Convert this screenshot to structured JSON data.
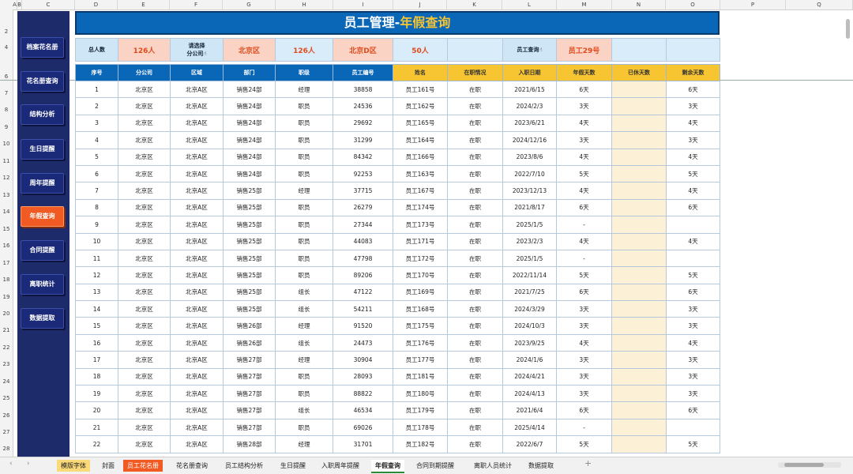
{
  "columns": [
    "A",
    "B",
    "C",
    "D",
    "E",
    "F",
    "G",
    "H",
    "I",
    "J",
    "K",
    "L",
    "M",
    "N",
    "O",
    "P",
    "Q"
  ],
  "rows": [
    "2",
    "4",
    "6",
    "7",
    "8",
    "9",
    "10",
    "11",
    "12",
    "13",
    "14",
    "15",
    "16",
    "17",
    "18",
    "19",
    "20",
    "21",
    "22",
    "23",
    "24",
    "25",
    "26",
    "27",
    "28"
  ],
  "sidebar": [
    {
      "label": "档案花名册",
      "active": false
    },
    {
      "label": "花名册查询",
      "active": false
    },
    {
      "label": "结构分析",
      "active": false
    },
    {
      "label": "生日提醒",
      "active": false
    },
    {
      "label": "周年提醒",
      "active": false
    },
    {
      "label": "年假查询",
      "active": true
    },
    {
      "label": "合同提醒",
      "active": false
    },
    {
      "label": "离职统计",
      "active": false
    },
    {
      "label": "数据提取",
      "active": false
    }
  ],
  "title": {
    "main": "员工管理-",
    "accent": "年假查询"
  },
  "info": {
    "total_label": "总人数",
    "total_value": "126人",
    "select_label": "请选择\n分公司☝",
    "branch_value": "北京区",
    "branch_count": "126人",
    "district_value": "北京D区",
    "district_count": "50人",
    "emp_query_label": "员工查询☝",
    "emp_query_value": "员工29号"
  },
  "headers": [
    "序号",
    "分公司",
    "区域",
    "部门",
    "职级",
    "员工编号",
    "姓名",
    "在职情况",
    "入职日期",
    "年假天数",
    "已休天数",
    "剩余天数"
  ],
  "table": [
    [
      "1",
      "北京区",
      "北京A区",
      "销售24部",
      "经理",
      "38858",
      "员工161号",
      "在职",
      "2021/6/15",
      "6天",
      "",
      "6天"
    ],
    [
      "2",
      "北京区",
      "北京A区",
      "销售24部",
      "职员",
      "24536",
      "员工162号",
      "在职",
      "2024/2/3",
      "3天",
      "",
      "3天"
    ],
    [
      "3",
      "北京区",
      "北京A区",
      "销售24部",
      "职员",
      "29692",
      "员工165号",
      "在职",
      "2023/6/21",
      "4天",
      "",
      "4天"
    ],
    [
      "4",
      "北京区",
      "北京A区",
      "销售24部",
      "职员",
      "31299",
      "员工164号",
      "在职",
      "2024/12/16",
      "3天",
      "",
      "3天"
    ],
    [
      "5",
      "北京区",
      "北京A区",
      "销售24部",
      "职员",
      "84342",
      "员工166号",
      "在职",
      "2023/8/6",
      "4天",
      "",
      "4天"
    ],
    [
      "6",
      "北京区",
      "北京A区",
      "销售24部",
      "职员",
      "92253",
      "员工163号",
      "在职",
      "2022/7/10",
      "5天",
      "",
      "5天"
    ],
    [
      "7",
      "北京区",
      "北京A区",
      "销售25部",
      "经理",
      "37715",
      "员工167号",
      "在职",
      "2023/12/13",
      "4天",
      "",
      "4天"
    ],
    [
      "8",
      "北京区",
      "北京A区",
      "销售25部",
      "职员",
      "26279",
      "员工174号",
      "在职",
      "2021/8/17",
      "6天",
      "",
      "6天"
    ],
    [
      "9",
      "北京区",
      "北京A区",
      "销售25部",
      "职员",
      "27344",
      "员工173号",
      "在职",
      "2025/1/5",
      "-",
      "",
      ""
    ],
    [
      "10",
      "北京区",
      "北京A区",
      "销售25部",
      "职员",
      "44083",
      "员工171号",
      "在职",
      "2023/2/3",
      "4天",
      "",
      "4天"
    ],
    [
      "11",
      "北京区",
      "北京A区",
      "销售25部",
      "职员",
      "47798",
      "员工172号",
      "在职",
      "2025/1/5",
      "-",
      "",
      ""
    ],
    [
      "12",
      "北京区",
      "北京A区",
      "销售25部",
      "职员",
      "89206",
      "员工170号",
      "在职",
      "2022/11/14",
      "5天",
      "",
      "5天"
    ],
    [
      "13",
      "北京区",
      "北京A区",
      "销售25部",
      "组长",
      "47122",
      "员工169号",
      "在职",
      "2021/7/25",
      "6天",
      "",
      "6天"
    ],
    [
      "14",
      "北京区",
      "北京A区",
      "销售25部",
      "组长",
      "54211",
      "员工168号",
      "在职",
      "2024/3/29",
      "3天",
      "",
      "3天"
    ],
    [
      "15",
      "北京区",
      "北京A区",
      "销售26部",
      "经理",
      "91520",
      "员工175号",
      "在职",
      "2024/10/3",
      "3天",
      "",
      "3天"
    ],
    [
      "16",
      "北京区",
      "北京A区",
      "销售26部",
      "组长",
      "24473",
      "员工176号",
      "在职",
      "2023/9/25",
      "4天",
      "",
      "4天"
    ],
    [
      "17",
      "北京区",
      "北京A区",
      "销售27部",
      "经理",
      "30904",
      "员工177号",
      "在职",
      "2024/1/6",
      "3天",
      "",
      "3天"
    ],
    [
      "18",
      "北京区",
      "北京A区",
      "销售27部",
      "职员",
      "28093",
      "员工181号",
      "在职",
      "2024/4/21",
      "3天",
      "",
      "3天"
    ],
    [
      "19",
      "北京区",
      "北京A区",
      "销售27部",
      "职员",
      "88822",
      "员工180号",
      "在职",
      "2024/4/13",
      "3天",
      "",
      "3天"
    ],
    [
      "20",
      "北京区",
      "北京A区",
      "销售27部",
      "组长",
      "46534",
      "员工179号",
      "在职",
      "2021/6/4",
      "6天",
      "",
      "6天"
    ],
    [
      "21",
      "北京区",
      "北京A区",
      "销售27部",
      "职员",
      "69026",
      "员工178号",
      "在职",
      "2025/4/14",
      "-",
      "",
      ""
    ],
    [
      "22",
      "北京区",
      "北京A区",
      "销售28部",
      "经理",
      "31701",
      "员工182号",
      "在职",
      "2022/6/7",
      "5天",
      "",
      "5天"
    ]
  ],
  "tabs": [
    {
      "label": "模版字体",
      "style": "yel"
    },
    {
      "label": "封面",
      "style": ""
    },
    {
      "label": "员工花名册",
      "style": "org"
    },
    {
      "label": "花名册查询",
      "style": ""
    },
    {
      "label": "员工结构分析",
      "style": ""
    },
    {
      "label": "生日提醒",
      "style": ""
    },
    {
      "label": "入职周年提醒",
      "style": ""
    },
    {
      "label": "年假查询",
      "style": "act"
    },
    {
      "label": "合同到期提醒",
      "style": ""
    },
    {
      "label": "离职人员统计",
      "style": ""
    },
    {
      "label": "数据提取",
      "style": ""
    }
  ],
  "add_tab": "+",
  "colors": {
    "brand_blue": "#0a66b7",
    "accent_yellow": "#f7c531",
    "active_orange": "#f15a22",
    "sidebar": "#1e2b6b"
  },
  "icons": {
    "nav_prev": "chevron-left-icon",
    "nav_next": "chevron-right-icon",
    "add": "plus-icon"
  }
}
